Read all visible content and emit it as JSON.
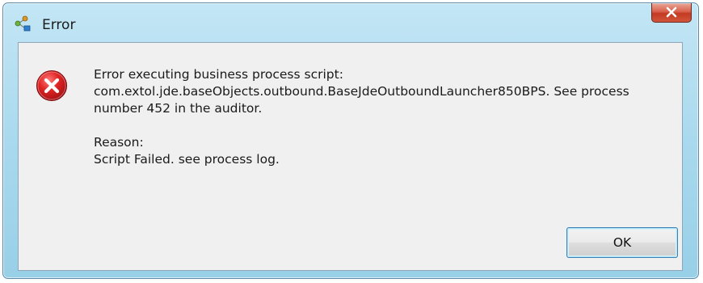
{
  "dialog": {
    "title": "Error",
    "message_line1": "Error executing business process script:",
    "message_line2": "com.extol.jde.baseObjects.outbound.BaseJdeOutboundLauncher850BPS. See process",
    "message_line3": "number 452 in the auditor.",
    "reason_label": "Reason:",
    "reason_text": "Script Failed. see process log.",
    "ok_label": "OK",
    "close_glyph": "X",
    "icons": {
      "app": "process-diagram-icon",
      "status": "error-icon",
      "close": "close-icon"
    },
    "colors": {
      "titlebar": "#a9d9ee",
      "client_bg": "#f0f0f0",
      "close_button": "#c33a22",
      "error_red": "#c8161d",
      "ok_border": "#3c7fb1"
    }
  }
}
